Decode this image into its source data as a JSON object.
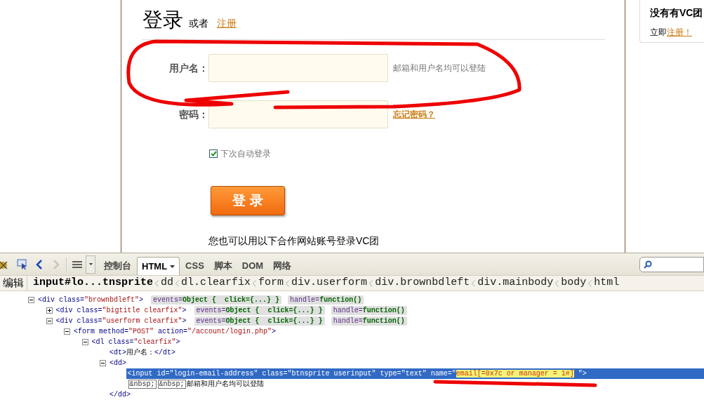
{
  "login": {
    "heading": "登录",
    "or_text": "或者",
    "register_link": "注册",
    "fields": [
      {
        "label": "用户名：",
        "hint": "邮箱和用户名均可以登陆"
      },
      {
        "label": "密码：",
        "link": "忘记密码？"
      }
    ],
    "remember": {
      "label": "下次自动登录",
      "checked": true
    },
    "submit": "登 录",
    "partner_text": "您也可以用以下合作网站账号登录VC团"
  },
  "sidebar": {
    "title": "没有有VC团",
    "prefix": "立即",
    "link": "注册！"
  },
  "devtools": {
    "tabs": [
      {
        "label": "控制台",
        "selected": false,
        "has_menu": false
      },
      {
        "label": "HTML",
        "selected": true,
        "has_menu": true
      },
      {
        "label": "CSS",
        "selected": false,
        "has_menu": false
      },
      {
        "label": "脚本",
        "selected": false,
        "has_menu": false
      },
      {
        "label": "DOM",
        "selected": false,
        "has_menu": false
      },
      {
        "label": "网络",
        "selected": false,
        "has_menu": false
      }
    ],
    "edit": "编辑",
    "breadcrumb": [
      {
        "label": "input#lo...tnsprite",
        "selected": true
      },
      {
        "label": "dd",
        "selected": false
      },
      {
        "label": "dl.clearfix",
        "selected": false
      },
      {
        "label": "form",
        "selected": false
      },
      {
        "label": "div.userform",
        "selected": false
      },
      {
        "label": "div.brownbdleft",
        "selected": false
      },
      {
        "label": "div.mainbody",
        "selected": false
      },
      {
        "label": "body",
        "selected": false
      },
      {
        "label": "html",
        "selected": false
      }
    ],
    "tree": [
      {
        "expanded": true,
        "selected": false,
        "tokens": [
          {
            "kind": "tag",
            "text": "<div"
          },
          {
            "kind": "attr",
            "text": " class="
          },
          {
            "kind": "value",
            "text": "\"brownbdleft\""
          },
          {
            "kind": "tag",
            "text": ">"
          }
        ],
        "badges": [
          {
            "key": "events=",
            "value": "Object {  click={...} }"
          },
          {
            "key": "handle=",
            "value": "function()"
          }
        ],
        "children": [
          {
            "expanded": false,
            "selected": false,
            "tokens": [
              {
                "kind": "tag",
                "text": "<div"
              },
              {
                "kind": "attr",
                "text": " class="
              },
              {
                "kind": "value",
                "text": "\"bigtitle clearfix\""
              },
              {
                "kind": "tag",
                "text": ">"
              }
            ],
            "badges": [
              {
                "key": "events=",
                "value": "Object {  click={...} }"
              },
              {
                "key": "handle=",
                "value": "function()"
              }
            ]
          },
          {
            "expanded": true,
            "selected": false,
            "tokens": [
              {
                "kind": "tag",
                "text": "<div"
              },
              {
                "kind": "attr",
                "text": " class="
              },
              {
                "kind": "value",
                "text": "\"userform clearfix\""
              },
              {
                "kind": "tag",
                "text": ">"
              }
            ],
            "badges": [
              {
                "key": "events=",
                "value": "Object {  click={...} }"
              },
              {
                "key": "handle=",
                "value": "function()"
              }
            ],
            "children": [
              {
                "expanded": true,
                "selected": false,
                "tokens": [
                  {
                    "kind": "tag",
                    "text": "<form"
                  },
                  {
                    "kind": "attr",
                    "text": " method="
                  },
                  {
                    "kind": "value",
                    "text": "\"POST\""
                  },
                  {
                    "kind": "attr",
                    "text": " action="
                  },
                  {
                    "kind": "value",
                    "text": "\"/account/login.php\""
                  },
                  {
                    "kind": "tag",
                    "text": ">"
                  }
                ],
                "children": [
                  {
                    "expanded": true,
                    "selected": false,
                    "tokens": [
                      {
                        "kind": "tag",
                        "text": "<dl"
                      },
                      {
                        "kind": "attr",
                        "text": " class="
                      },
                      {
                        "kind": "value",
                        "text": "\"clearfix\""
                      },
                      {
                        "kind": "tag",
                        "text": ">"
                      }
                    ],
                    "children": [
                      {
                        "selected": false,
                        "tokens": [
                          {
                            "kind": "tag",
                            "text": "<dt>"
                          },
                          {
                            "kind": "text",
                            "text": "用户名："
                          },
                          {
                            "kind": "tag",
                            "text": "</dt>"
                          }
                        ]
                      },
                      {
                        "expanded": true,
                        "selected": false,
                        "tokens": [
                          {
                            "kind": "tag",
                            "text": "<dd>"
                          }
                        ],
                        "children": [
                          {
                            "selected": true,
                            "tokens": [
                              {
                                "kind": "tag",
                                "text": "<input"
                              },
                              {
                                "kind": "attr",
                                "text": " id="
                              },
                              {
                                "kind": "value",
                                "text": "\"login-email-address\""
                              },
                              {
                                "kind": "attr",
                                "text": " class="
                              },
                              {
                                "kind": "value",
                                "text": "\"btnsprite userinput\""
                              },
                              {
                                "kind": "attr",
                                "text": " type="
                              },
                              {
                                "kind": "value",
                                "text": "\"text\""
                              },
                              {
                                "kind": "attr",
                                "text": " name="
                              },
                              {
                                "kind": "value",
                                "text": "\""
                              },
                              {
                                "kind": "highlight",
                                "text": "email[=0x7c or manager = 1#]"
                              },
                              {
                                "kind": "value",
                                "text": " \""
                              },
                              {
                                "kind": "tag",
                                "text": ">"
                              }
                            ]
                          },
                          {
                            "selected": false,
                            "tokens": [
                              {
                                "kind": "entity",
                                "text": "&nbsp;"
                              },
                              {
                                "kind": "entity",
                                "text": "&nbsp;"
                              },
                              {
                                "kind": "text",
                                "text": "邮箱和用户名均可以登陆"
                              }
                            ]
                          }
                        ]
                      },
                      {
                        "selected": false,
                        "tokens": [
                          {
                            "kind": "tag",
                            "text": "</dd>"
                          }
                        ]
                      }
                    ]
                  }
                ]
              }
            ]
          }
        ]
      }
    ]
  }
}
